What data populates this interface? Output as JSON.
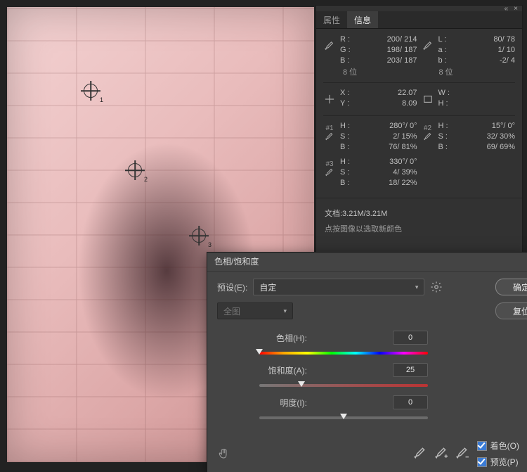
{
  "panel": {
    "tabs": {
      "properties": "属性",
      "info": "信息"
    },
    "rgb": {
      "R": "R :",
      "G": "G :",
      "B": "B :",
      "rv": "200/ 214",
      "gv": "198/ 187",
      "bv": "203/ 187"
    },
    "lab": {
      "L": "L :",
      "a": "a :",
      "b": "b :",
      "lv": "80/  78",
      "av": "1/  10",
      "bv": "-2/   4"
    },
    "bits": "8 位",
    "xy": {
      "X": "X :",
      "Y": "Y :",
      "xv": "22.07",
      "yv": "8.09"
    },
    "wh": {
      "W": "W :",
      "H": "H :",
      "wv": "",
      "hv": ""
    },
    "s1": {
      "tag": "#1",
      "H": "H :",
      "S": "S :",
      "B": "B :",
      "hv": "280°/   0°",
      "sv": "2/ 15%",
      "bv": "76/ 81%"
    },
    "s2": {
      "tag": "#2",
      "H": "H :",
      "S": "S :",
      "B": "B :",
      "hv": "15°/   0°",
      "sv": "32/ 30%",
      "bv": "69/ 69%"
    },
    "s3": {
      "tag": "#3",
      "H": "H :",
      "S": "S :",
      "B": "B :",
      "hv": "330°/   0°",
      "sv": "4/ 39%",
      "bv": "18/ 22%"
    },
    "doc": "文档:3.21M/3.21M",
    "hint": "点按图像以选取新颜色"
  },
  "dlg": {
    "title": "色相/饱和度",
    "preset_lbl": "预设(E):",
    "preset_val": "自定",
    "ok": "确定",
    "cancel": "复位",
    "range": "全图",
    "hue_lbl": "色相(H):",
    "hue_val": "0",
    "sat_lbl": "饱和度(A):",
    "sat_val": "25",
    "lig_lbl": "明度(I):",
    "lig_val": "0",
    "colorize": "着色(O)",
    "preview": "预览(P)"
  }
}
